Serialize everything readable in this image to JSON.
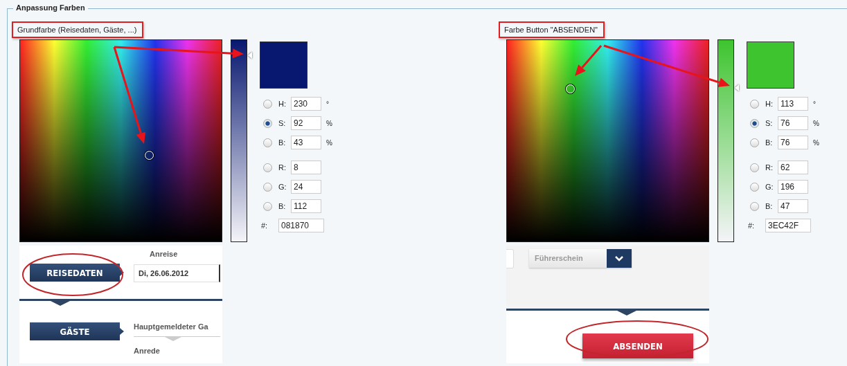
{
  "legend": "Anpassung Farben",
  "pickers": [
    {
      "label": "Grundfarbe (Reisedaten, Gäste, ...)",
      "hex_label": "#:",
      "hex": "081870",
      "slider": {
        "level": 0.92
      },
      "fields": [
        {
          "kind": "hue",
          "letter": "H:",
          "value": "230",
          "unit": "°",
          "selected": false
        },
        {
          "kind": "saturation",
          "letter": "S:",
          "value": "92",
          "unit": "%",
          "selected": true
        },
        {
          "kind": "brightness",
          "letter": "B:",
          "value": "43",
          "unit": "%",
          "selected": false
        },
        {
          "kind": "red",
          "letter": "R:",
          "value": "8",
          "selected": false
        },
        {
          "kind": "green",
          "letter": "G:",
          "value": "24",
          "selected": false
        },
        {
          "kind": "blue",
          "letter": "B:",
          "value": "112",
          "selected": false
        }
      ],
      "preview": {
        "kind": "travel-form",
        "date_label": "Anreise",
        "tab_1": "REISEDATEN",
        "date_value": "Di, 26.06.2012",
        "tab_2": "GÄSTE",
        "guest_label": "Hauptgemeldeter Ga",
        "salutation_label": "Anrede"
      }
    },
    {
      "label": "Farbe Button \"ABSENDEN\"",
      "hex_label": "#:",
      "hex": "3EC42F",
      "slider": {
        "level": 0.76
      },
      "fields": [
        {
          "kind": "hue",
          "letter": "H:",
          "value": "113",
          "unit": "°",
          "selected": false
        },
        {
          "kind": "saturation",
          "letter": "S:",
          "value": "76",
          "unit": "%",
          "selected": true
        },
        {
          "kind": "brightness",
          "letter": "B:",
          "value": "76",
          "unit": "%",
          "selected": false
        },
        {
          "kind": "red",
          "letter": "R:",
          "value": "62",
          "selected": false
        },
        {
          "kind": "green",
          "letter": "G:",
          "value": "196",
          "selected": false
        },
        {
          "kind": "blue",
          "letter": "B:",
          "value": "47",
          "selected": false
        }
      ],
      "preview": {
        "kind": "submit-form",
        "select_placeholder": "Führerschein",
        "submit": "ABSENDEN"
      }
    }
  ]
}
